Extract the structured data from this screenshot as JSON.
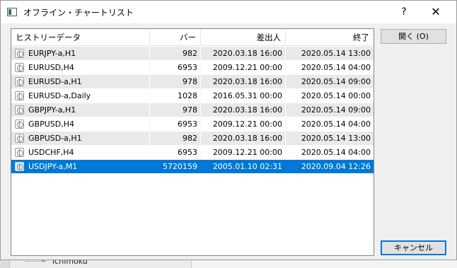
{
  "window": {
    "title": "オフライン・チャートリスト",
    "help_label": "?",
    "close_label": "✕"
  },
  "columns": {
    "name": "ヒストリーデータ",
    "bars": "バー",
    "from": "差出人",
    "to": "終了"
  },
  "rows": [
    {
      "name": "EURJPY-a,H1",
      "bars": "982",
      "from": "2020.03.18 16:00",
      "to": "2020.05.14 13:00"
    },
    {
      "name": "EURUSD,H4",
      "bars": "6953",
      "from": "2009.12.21 00:00",
      "to": "2020.05.14 04:00"
    },
    {
      "name": "EURUSD-a,H1",
      "bars": "978",
      "from": "2020.03.18 16:00",
      "to": "2020.05.14 09:00"
    },
    {
      "name": "EURUSD-a,Daily",
      "bars": "1028",
      "from": "2016.05.31 00:00",
      "to": "2020.05.14 00:00"
    },
    {
      "name": "GBPJPY-a,H1",
      "bars": "978",
      "from": "2020.03.18 16:00",
      "to": "2020.05.14 09:00"
    },
    {
      "name": "GBPUSD,H4",
      "bars": "6953",
      "from": "2009.12.21 00:00",
      "to": "2020.05.14 04:00"
    },
    {
      "name": "GBPUSD-a,H1",
      "bars": "982",
      "from": "2020.03.18 16:00",
      "to": "2020.05.14 13:00"
    },
    {
      "name": "USDCHF,H4",
      "bars": "6953",
      "from": "2009.12.21 00:00",
      "to": "2020.05.14 04:00"
    },
    {
      "name": "USDJPY-a,M1",
      "bars": "5720159",
      "from": "2005.01.10 02:31",
      "to": "2020.09.04 12:26"
    }
  ],
  "selected_row": "USDJPY-a,M1",
  "buttons": {
    "open": "開く (O)",
    "cancel": "キャンセル"
  },
  "background": {
    "tree_item": "Ichimoku"
  },
  "colors": {
    "selection": "#0078d7",
    "alt_row": "#e9e9e9"
  }
}
